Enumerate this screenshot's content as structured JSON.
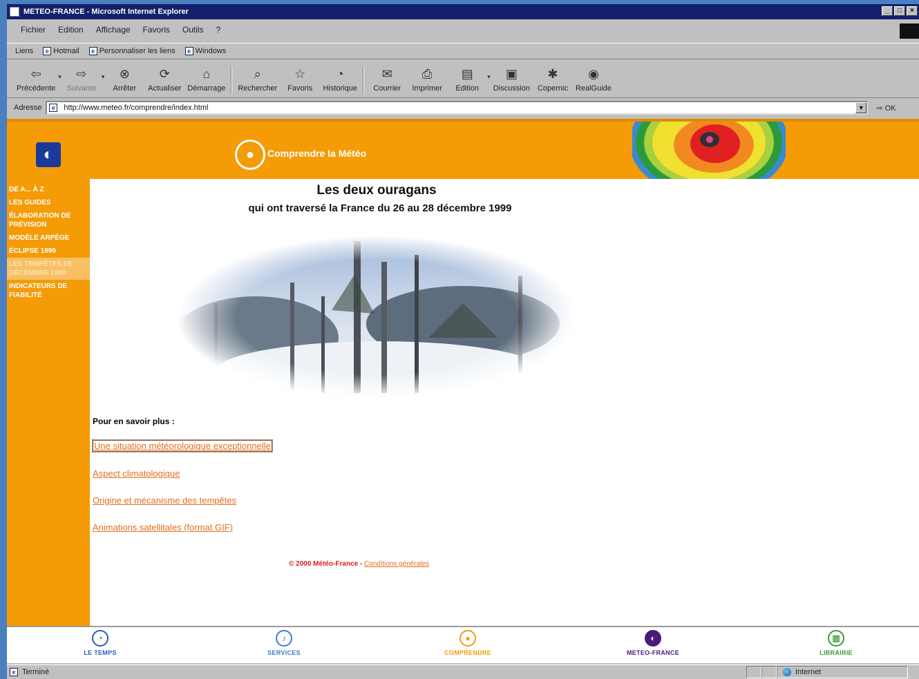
{
  "window": {
    "title": "METEO-FRANCE - Microsoft Internet Explorer"
  },
  "menu": [
    "Fichier",
    "Edition",
    "Affichage",
    "Favoris",
    "Outils",
    "?"
  ],
  "links_bar": {
    "label": "Liens",
    "items": [
      "Hotmail",
      "Personnaliser les liens",
      "Windows"
    ]
  },
  "toolbar": {
    "buttons": [
      "Précédente",
      "Suivante",
      "Arrêter",
      "Actualiser",
      "Démarrage",
      "Rechercher",
      "Favoris",
      "Historique",
      "Courrier",
      "Imprimer",
      "Edition",
      "Discussion",
      "Copernic",
      "RealGuide"
    ]
  },
  "address": {
    "label": "Adresse",
    "url": "http://www.meteo.fr/comprendre/index.html",
    "go": "OK"
  },
  "banner": {
    "title": "Comprendre la Météo"
  },
  "sidenav": {
    "items": [
      "DE A... à Z",
      "LES GUIDES",
      "ÉLABORATION DE PRÉVISION",
      "MODÈLE ARPÈGE",
      "ÉCLIPSE 1999",
      "LES TEMPÊTES DE DÉCEMBRE 1999",
      "INDICATEURS DE FIABILITÉ"
    ]
  },
  "content": {
    "title": "Les deux ouragans",
    "subtitle": "qui ont traversé la France du 26 au 28 décembre 1999",
    "more_label": "Pour en savoir plus :",
    "links": [
      "Une situation météorologique exceptionnelle",
      "Aspect climatologique",
      "Origine et mécanisme des tempêtes",
      "Animations satellitales (format GIF)"
    ],
    "footer_copyright": "© 2000 Météo-France -",
    "footer_conditions": "Conditions générales"
  },
  "bottom_nav": [
    "LE TEMPS",
    "SERVICES",
    "COMPRENDRE",
    "METEO-FRANCE",
    "LIBRAIRIE"
  ],
  "status": {
    "text": "Terminé",
    "zone": "Internet"
  },
  "colors": {
    "orange": "#f49b06",
    "title_bar": "#14206a",
    "link": "#e46d1c"
  }
}
